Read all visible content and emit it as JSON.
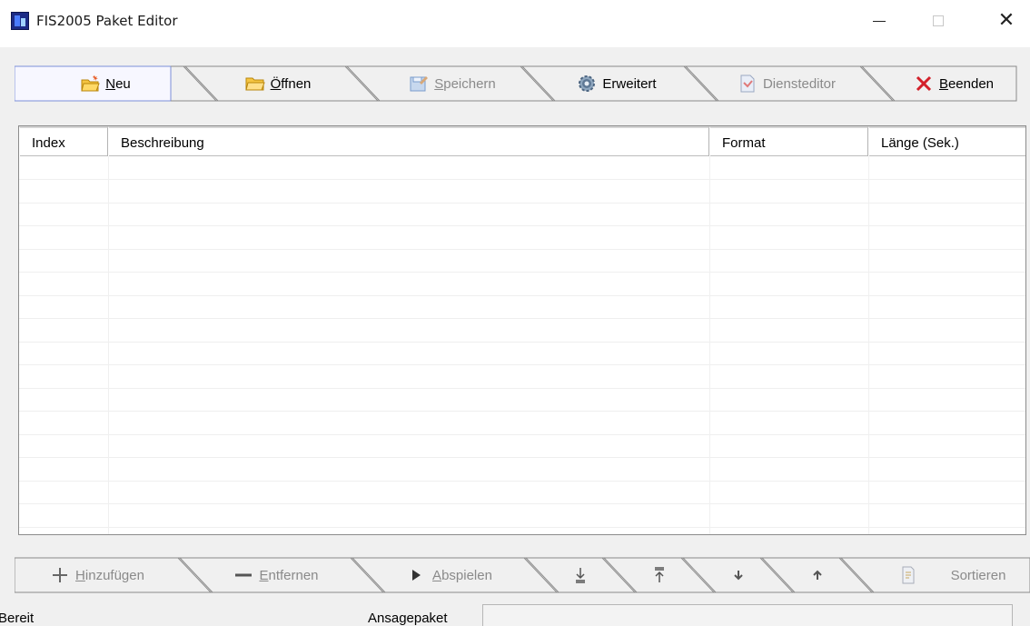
{
  "window": {
    "title": "FIS2005 Paket Editor",
    "controls": {
      "minimize": "minimize-icon",
      "maximize": "maximize-icon",
      "close": "✕"
    }
  },
  "toolbar": {
    "items": [
      {
        "label_pre": "",
        "label_ul": "N",
        "label_post": "eu",
        "icon": "new-folder-icon",
        "enabled": true,
        "active": true
      },
      {
        "label_pre": "",
        "label_ul": "Ö",
        "label_post": "ffnen",
        "icon": "open-folder-icon",
        "enabled": true
      },
      {
        "label_pre": "",
        "label_ul": "S",
        "label_post": "peichern",
        "icon": "save-icon",
        "enabled": false
      },
      {
        "label_pre": "",
        "label_ul": "",
        "label_post": "Erweitert",
        "icon": "gear-icon",
        "enabled": true
      },
      {
        "label_pre": "",
        "label_ul": "",
        "label_post": "Diensteditor",
        "icon": "document-icon",
        "enabled": false
      },
      {
        "label_pre": "",
        "label_ul": "B",
        "label_post": "eenden",
        "icon": "close-icon",
        "enabled": true
      }
    ]
  },
  "table": {
    "columns": [
      "Index",
      "Beschreibung",
      "Format",
      "Länge (Sek.)"
    ],
    "rows": []
  },
  "actions": {
    "items": [
      {
        "label_pre": "",
        "label_ul": "H",
        "label_post": "inzufügen",
        "icon": "plus-icon",
        "enabled": false
      },
      {
        "label_pre": "",
        "label_ul": "E",
        "label_post": "ntfernen",
        "icon": "minus-icon",
        "enabled": false
      },
      {
        "label_pre": "",
        "label_ul": "A",
        "label_post": "bspielen",
        "icon": "play-icon",
        "enabled": false
      },
      {
        "label_pre": "",
        "label_ul": "",
        "label_post": "",
        "icon": "move-to-bottom-icon",
        "enabled": false
      },
      {
        "label_pre": "",
        "label_ul": "",
        "label_post": "",
        "icon": "move-to-top-icon",
        "enabled": false
      },
      {
        "label_pre": "",
        "label_ul": "",
        "label_post": "",
        "icon": "move-down-icon",
        "enabled": false
      },
      {
        "label_pre": "",
        "label_ul": "",
        "label_post": "",
        "icon": "move-up-icon",
        "enabled": false
      },
      {
        "label_pre": "",
        "label_ul": "",
        "label_post": "Sortieren",
        "icon": "sort-icon",
        "enabled": false
      }
    ]
  },
  "status": {
    "text": "Bereit",
    "package_label": "Ansagepaket",
    "package_value": ""
  }
}
